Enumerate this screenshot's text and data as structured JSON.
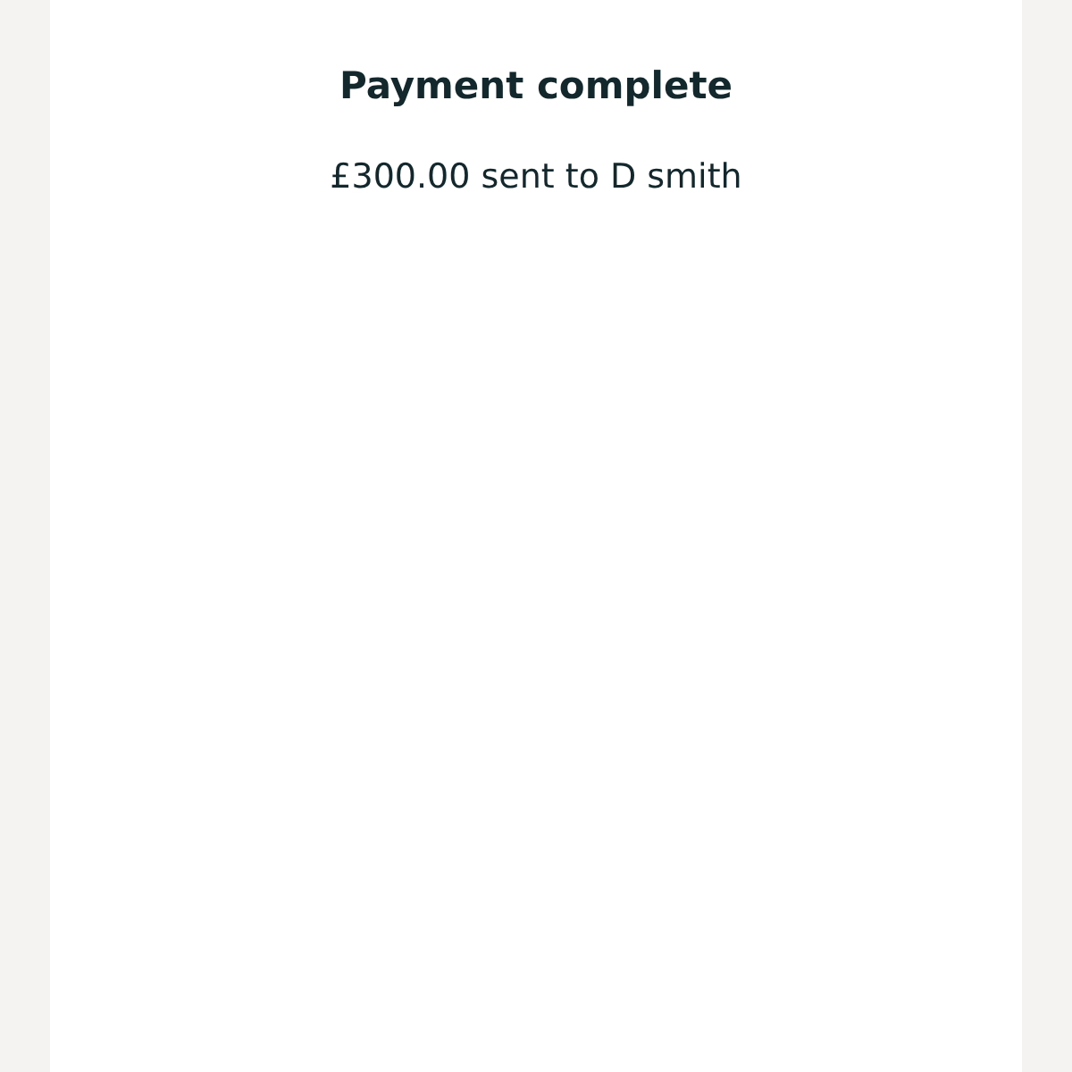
{
  "title": "Payment complete",
  "message": "£300.00 sent to D smith"
}
